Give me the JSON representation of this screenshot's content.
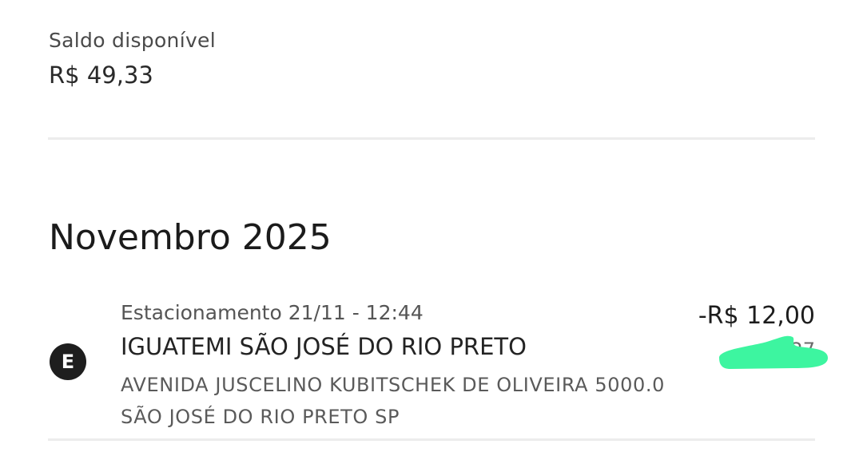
{
  "balance": {
    "label": "Saldo disponível",
    "value": "R$ 49,33"
  },
  "month": {
    "title": "Novembro 2025"
  },
  "transaction": {
    "icon_letter": "E",
    "icon_name": "parking-e-icon",
    "subtitle": "Estacionamento 21/11 - 12:44",
    "title": "IGUATEMI SÃO JOSÉ DO RIO PRETO",
    "address": "AVENIDA JUSCELINO KUBITSCHEK DE OLIVEIRA 5000.0 SÃO JOSÉ DO RIO PRETO SP",
    "amount": "-R$ 12,00",
    "secondary_partial": "F    27"
  },
  "colors": {
    "redaction": "#3DF5A0",
    "icon_background": "#1E1E1E",
    "divider": "#ECECEC"
  }
}
